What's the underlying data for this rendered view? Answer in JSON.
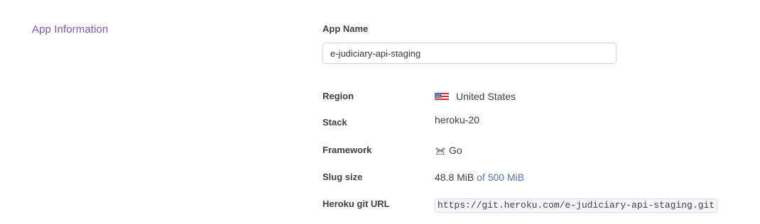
{
  "section": {
    "title": "App Information"
  },
  "app_name": {
    "label": "App Name",
    "value": "e-judiciary-api-staging"
  },
  "info": {
    "region": {
      "label": "Region",
      "value": "United States",
      "icon": "us-flag-icon"
    },
    "stack": {
      "label": "Stack",
      "value": "heroku-20"
    },
    "framework": {
      "label": "Framework",
      "value": "Go",
      "icon": "go-gopher-icon"
    },
    "slug_size": {
      "label": "Slug size",
      "value": "48.8 MiB",
      "limit": "of 500 MiB"
    },
    "git_url": {
      "label": "Heroku git URL",
      "value": "https://git.heroku.com/e-judiciary-api-staging.git"
    }
  },
  "colors": {
    "section_title": "#79589f",
    "label_text": "#3f3f44",
    "muted_value": "#5a73a8",
    "input_border": "#cfd7e6"
  }
}
